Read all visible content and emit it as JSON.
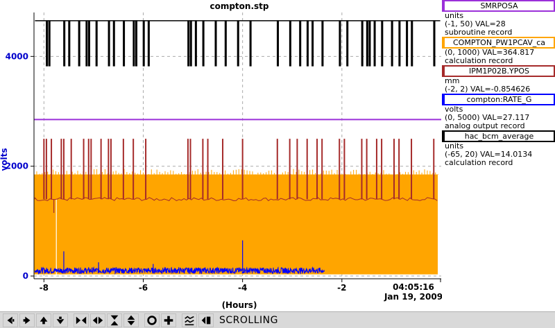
{
  "chart_data": {
    "type": "line",
    "title": "compton.stp",
    "xlabel": "(Hours)",
    "ylabel": "volts",
    "xlim": [
      -8.2,
      0
    ],
    "ylim": [
      -50,
      4800
    ],
    "x_ticks": [
      -8,
      -6,
      -4,
      -2
    ],
    "x_tick_labels": [
      "-8",
      "-6",
      "-4",
      "-2"
    ],
    "y_ticks": [
      0,
      2000,
      4000
    ],
    "y_tick_labels": [
      "0",
      "2000",
      "4000"
    ],
    "end_time": "04:05:16",
    "end_date": "Jan 19, 2009",
    "grid": true,
    "series": [
      {
        "name": "SMRPOSA",
        "color": "#9b30d9",
        "style": "flat",
        "level": 2850
      },
      {
        "name": "hac_bcm_average",
        "color": "#000000",
        "style": "telegraph",
        "high": 4650,
        "low": 3830,
        "dropouts": [
          -7.95,
          -7.9,
          -7.6,
          -7.5,
          -7.3,
          -7.15,
          -7.1,
          -6.95,
          -6.7,
          -6.6,
          -6.4,
          -6.2,
          -6.15,
          -6.0,
          -5.9,
          -5.1,
          -5.05,
          -4.95,
          -4.8,
          -4.55,
          -4.35,
          -4.1,
          -3.85,
          -3.3,
          -3.05,
          -2.85,
          -2.7,
          -2.6,
          -2.4,
          -2.05,
          -1.9,
          -1.6,
          -1.5,
          -1.45,
          -1.35,
          -1.2,
          -1.0,
          -0.85,
          -0.7,
          -0.6,
          -0.15
        ]
      },
      {
        "name": "COMPTON_PW1PCAV_ca",
        "color": "#ffa500",
        "style": "band",
        "low": 30,
        "high": 1850,
        "peak": 1950
      },
      {
        "name": "IPM1P02B.YPOS",
        "color": "#a52a2a",
        "style": "spikes",
        "base": 1400,
        "spike": 2500,
        "spikes": [
          -8.0,
          -7.95,
          -7.85,
          -7.65,
          -7.6,
          -7.45,
          -7.2,
          -7.1,
          -7.05,
          -6.85,
          -6.7,
          -6.65,
          -6.4,
          -6.2,
          -5.95,
          -5.1,
          -5.05,
          -4.8,
          -4.7,
          -4.4,
          -4.0,
          -3.3,
          -3.05,
          -2.9,
          -2.7,
          -2.5,
          -2.4,
          -2.05,
          -1.95,
          -1.6,
          -1.5,
          -1.3,
          -1.2,
          -0.95,
          -0.85,
          -0.6,
          -0.15
        ]
      },
      {
        "name": "compton:RATE_G",
        "color": "#0000ff",
        "style": "noise",
        "level": 100,
        "end": -2.35
      }
    ]
  },
  "legend": [
    {
      "name": "SMRPOSA",
      "color": "#9b30d9",
      "units": "units",
      "range": "(-1, 50) VAL=28",
      "kind": "subroutine record"
    },
    {
      "name": "COMPTON_PW1PCAV_ca",
      "color": "#ffa500",
      "units": "",
      "range": "(0, 1000) VAL=364.817",
      "kind": "calculation record"
    },
    {
      "name": "IPM1P02B.YPOS",
      "color": "#a52a2a",
      "units": "mm",
      "range": "(-2, 2) VAL=-0.854626",
      "kind": ""
    },
    {
      "name": "compton:RATE_G",
      "color": "#0000ff",
      "units": "volts",
      "range": "(0, 5000) VAL=27.117",
      "kind": "analog output record"
    },
    {
      "name": "hac_bcm_average",
      "color": "#000000",
      "units": "units",
      "range": "(-65, 20) VAL=14.0134",
      "kind": "calculation record"
    }
  ],
  "toolbar": {
    "buttons": [
      {
        "name": "pan-left-icon",
        "glyph": "left"
      },
      {
        "name": "pan-right-icon",
        "glyph": "right"
      },
      {
        "name": "pan-up-icon",
        "glyph": "up"
      },
      {
        "name": "pan-down-icon",
        "glyph": "down"
      },
      {
        "name": "zoom-in-x-icon",
        "glyph": "zinx"
      },
      {
        "name": "zoom-out-x-icon",
        "glyph": "zoutx"
      },
      {
        "name": "zoom-in-y-icon",
        "glyph": "ziny"
      },
      {
        "name": "zoom-out-y-icon",
        "glyph": "zouty"
      },
      {
        "name": "auto-zoom-icon",
        "glyph": "circle"
      },
      {
        "name": "add-icon",
        "glyph": "plus"
      },
      {
        "name": "auto-scale-icon",
        "glyph": "scale"
      },
      {
        "name": "undo-icon",
        "glyph": "undo"
      }
    ],
    "status": "SCROLLING"
  }
}
